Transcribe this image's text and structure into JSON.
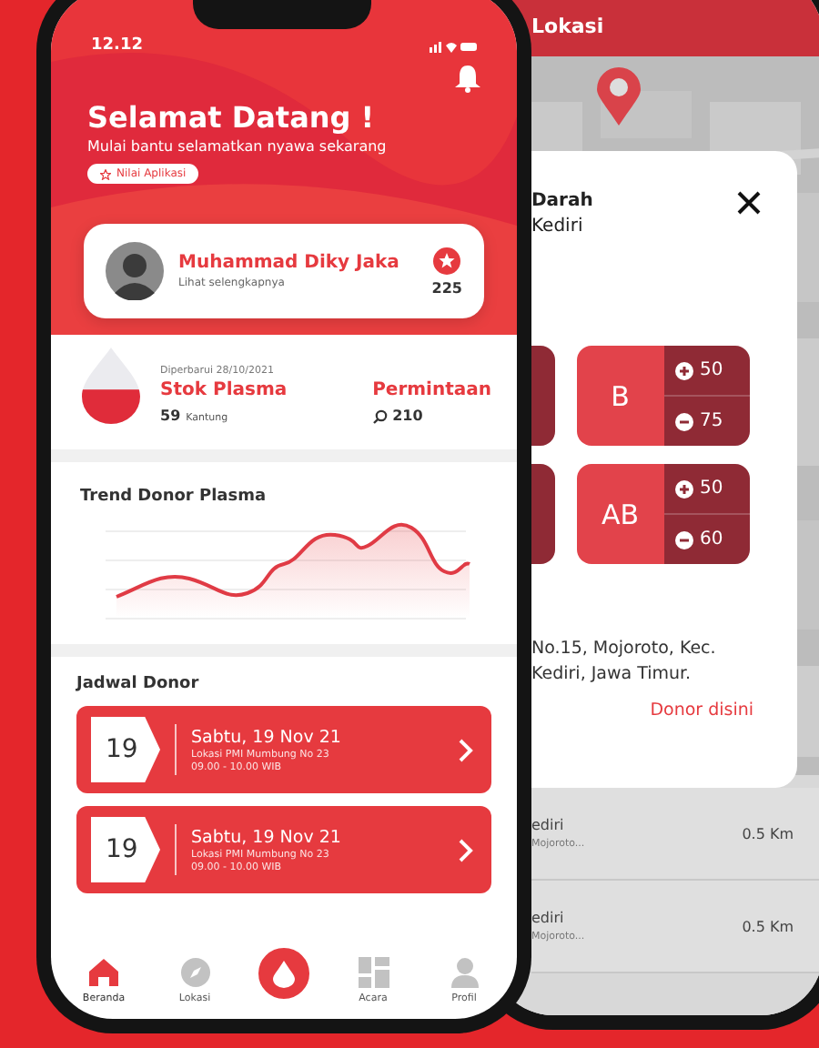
{
  "front_phone": {
    "status_bar": {
      "time": "12.12"
    },
    "header": {
      "title": "Selamat Datang !",
      "subtitle": "Mulai bantu selamatkan nyawa sekarang",
      "rate_button": "Nilai Aplikasi"
    },
    "profile": {
      "name": "Muhammad Diky Jaka",
      "link": "Lihat selengkapnya",
      "points": "225"
    },
    "stock": {
      "updated": "Diperbarui 28/10/2021",
      "title": "Stok Plasma",
      "count": "59",
      "unit": "Kantung",
      "level": 0.45,
      "request_title": "Permintaan",
      "request_count": "210"
    },
    "trend": {
      "title": "Trend Donor Plasma"
    },
    "schedule": {
      "title": "Jadwal Donor",
      "items": [
        {
          "day": "19",
          "date": "Sabtu, 19 Nov 21",
          "location": "Lokasi PMI Mumbung No 23",
          "time": "09.00 - 10.00 WIB"
        },
        {
          "day": "19",
          "date": "Sabtu, 19 Nov 21",
          "location": "Lokasi PMI Mumbung No 23",
          "time": "09.00 - 10.00 WIB"
        }
      ]
    },
    "nav": [
      {
        "kind": "home",
        "label": "Beranda",
        "selected": true
      },
      {
        "kind": "compass",
        "label": "Lokasi",
        "selected": false
      },
      {
        "kind": "fab"
      },
      {
        "kind": "grid",
        "label": "Acara",
        "selected": false
      },
      {
        "kind": "person",
        "label": "Profil",
        "selected": false
      }
    ]
  },
  "back_phone": {
    "header": {
      "title": "Lokasi"
    },
    "detail": {
      "title": "Darah",
      "subtitle": "Kediri",
      "blood_types": [
        {
          "type": "B",
          "plus": "50",
          "minus": "75"
        },
        {
          "type": "AB",
          "plus": "50",
          "minus": "60"
        }
      ],
      "address": "No.15, Mojoroto, Kec. Kediri, Jawa Timur.",
      "action": "Donor disini"
    },
    "locations": [
      {
        "name": "ediri",
        "address": "Mojoroto...",
        "distance": "0.5 Km"
      },
      {
        "name": "ediri",
        "address": "Mojoroto...",
        "distance": "0.5 Km"
      }
    ]
  }
}
